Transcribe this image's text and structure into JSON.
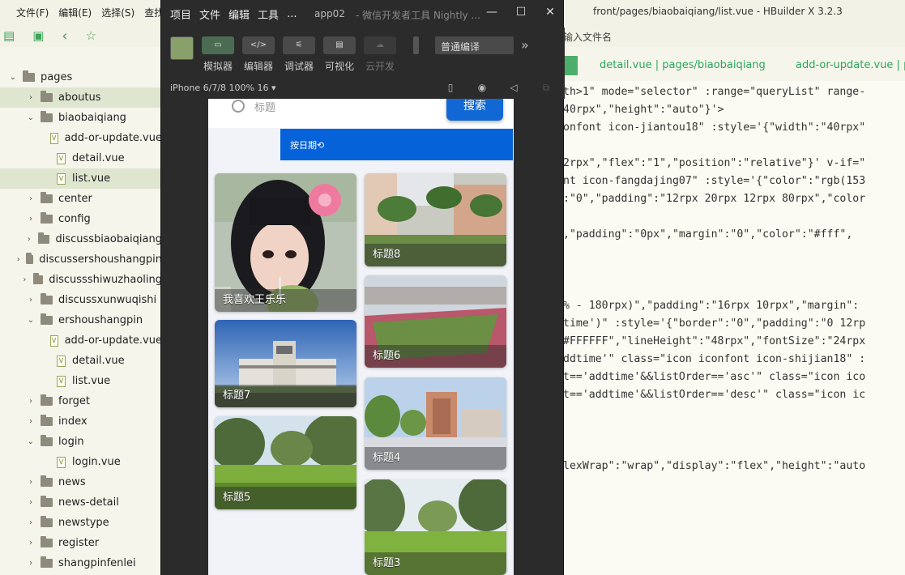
{
  "hbuilder": {
    "menu": [
      "文件(F)",
      "编辑(E)",
      "选择(S)",
      "查找"
    ],
    "title": "front/pages/biaobaiqiang/list.vue - HBuilder X 3.2.3",
    "search_files": "输入文件名",
    "tabs": [
      "detail.vue | pages/biaobaiqiang",
      "add-or-update.vue | p"
    ]
  },
  "tree": [
    {
      "label": "pages",
      "type": "folder",
      "open": true,
      "indent": 0
    },
    {
      "label": "aboutus",
      "type": "folder",
      "open": false,
      "indent": 1,
      "selected": true
    },
    {
      "label": "biaobaiqiang",
      "type": "folder",
      "open": true,
      "indent": 1
    },
    {
      "label": "add-or-update.vue",
      "type": "file",
      "indent": 2
    },
    {
      "label": "detail.vue",
      "type": "file",
      "indent": 2
    },
    {
      "label": "list.vue",
      "type": "file",
      "indent": 2,
      "selected": true
    },
    {
      "label": "center",
      "type": "folder",
      "open": false,
      "indent": 1
    },
    {
      "label": "config",
      "type": "folder",
      "open": false,
      "indent": 1
    },
    {
      "label": "discussbiaobaiqiang",
      "type": "folder",
      "open": false,
      "indent": 1
    },
    {
      "label": "discussershoushangpin",
      "type": "folder",
      "open": false,
      "indent": 1
    },
    {
      "label": "discussshiwuzhaoling",
      "type": "folder",
      "open": false,
      "indent": 1
    },
    {
      "label": "discussxunwuqishi",
      "type": "folder",
      "open": false,
      "indent": 1
    },
    {
      "label": "ershoushangpin",
      "type": "folder",
      "open": true,
      "indent": 1
    },
    {
      "label": "add-or-update.vue",
      "type": "file",
      "indent": 2
    },
    {
      "label": "detail.vue",
      "type": "file",
      "indent": 2
    },
    {
      "label": "list.vue",
      "type": "file",
      "indent": 2
    },
    {
      "label": "forget",
      "type": "folder",
      "open": false,
      "indent": 1
    },
    {
      "label": "index",
      "type": "folder",
      "open": false,
      "indent": 1
    },
    {
      "label": "login",
      "type": "folder",
      "open": true,
      "indent": 1
    },
    {
      "label": "login.vue",
      "type": "file",
      "indent": 2
    },
    {
      "label": "news",
      "type": "folder",
      "open": false,
      "indent": 1
    },
    {
      "label": "news-detail",
      "type": "folder",
      "open": false,
      "indent": 1
    },
    {
      "label": "newstype",
      "type": "folder",
      "open": false,
      "indent": 1
    },
    {
      "label": "register",
      "type": "folder",
      "open": false,
      "indent": 1
    },
    {
      "label": "shangpinfenlei",
      "type": "folder",
      "open": false,
      "indent": 1
    }
  ],
  "code_lines": [
    "th>1\" mode=\"selector\" :range=\"queryList\" range-",
    "40rpx\",\"height\":\"auto\"}'>",
    "onfont icon-jiantou18\" :style='{\"width\":\"40rpx\"",
    "",
    "2rpx\",\"flex\":\"1\",\"position\":\"relative\"}' v-if=\"",
    "nt icon-fangdajing07\" :style='{\"color\":\"rgb(153",
    ":\"0\",\"padding\":\"12rpx 20rpx 12rpx 80rpx\",\"color",
    "",
    ",\"padding\":\"0px\",\"margin\":\"0\",\"color\":\"#fff\",",
    "",
    "",
    "",
    "% - 180rpx)\",\"padding\":\"16rpx 10rpx\",\"margin\":",
    "time')\" :style='{\"border\":\"0\",\"padding\":\"0 12rp",
    "#FFFFFF\",\"lineHeight\":\"48rpx\",\"fontSize\":\"24rpx",
    "ddtime'\" class=\"icon iconfont icon-shijian18\" :",
    "t=='addtime'&&listOrder=='asc'\" class=\"icon ico",
    "t=='addtime'&&listOrder=='desc'\" class=\"icon ic",
    "",
    "",
    "",
    "lexWrap\":\"wrap\",\"display\":\"flex\",\"height\":\"auto"
  ],
  "simulator": {
    "menu": [
      "项目",
      "文件",
      "编辑",
      "工具",
      "..."
    ],
    "app_name": "app02",
    "subtitle": "- 微信开发者工具 Nightly ...",
    "tools": [
      {
        "label": "模拟器",
        "icon": "▭",
        "state": "active"
      },
      {
        "label": "编辑器",
        "icon": "</>",
        "state": "normal"
      },
      {
        "label": "调试器",
        "icon": "⚟",
        "state": "normal"
      },
      {
        "label": "可视化",
        "icon": "▤",
        "state": "normal"
      },
      {
        "label": "云开发",
        "icon": "☁",
        "state": "disabled"
      }
    ],
    "compile_mode": "普通编译",
    "device": "iPhone 6/7/8 100% 16 ▾"
  },
  "phone": {
    "search_placeholder": "标题",
    "search_button": "搜索",
    "sort_label": "按日期⟲",
    "cards_left": [
      {
        "title": "我喜欢王乐乐",
        "scene": "portrait"
      },
      {
        "title": "标题7",
        "scene": "building"
      },
      {
        "title": "标题5",
        "scene": "park"
      }
    ],
    "cards_right": [
      {
        "title": "标题8",
        "scene": "courtyard"
      },
      {
        "title": "标题6",
        "scene": "field"
      },
      {
        "title": "标题4",
        "scene": "campus"
      },
      {
        "title": "标题3",
        "scene": "park"
      }
    ]
  }
}
